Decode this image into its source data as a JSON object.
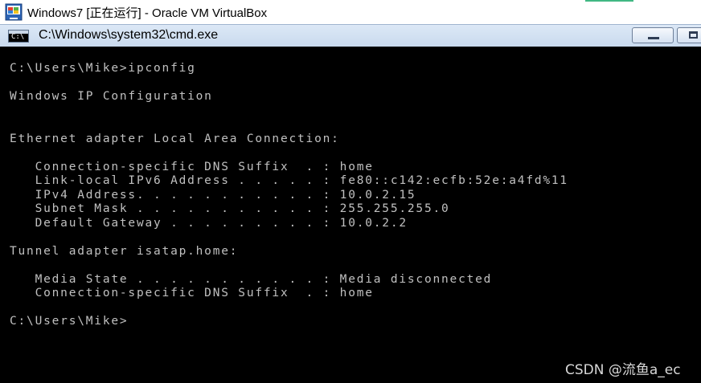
{
  "vbox": {
    "title": "Windows7 [正在运行] - Oracle VM VirtualBox"
  },
  "cmd": {
    "title": "C:\\Windows\\system32\\cmd.exe",
    "icon_glyph": "C:\\"
  },
  "console": {
    "lines": [
      "C:\\Users\\Mike>ipconfig",
      "Windows IP Configuration",
      "Ethernet adapter Local Area Connection:",
      "   Connection-specific DNS Suffix  . : home",
      "   Link-local IPv6 Address . . . . . : fe80::c142:ecfb:52e:a4fd%11",
      "   IPv4 Address. . . . . . . . . . . : 10.0.2.15",
      "   Subnet Mask . . . . . . . . . . . : 255.255.255.0",
      "   Default Gateway . . . . . . . . . : 10.0.2.2",
      "Tunnel adapter isatap.home:",
      "   Media State . . . . . . . . . . . : Media disconnected",
      "   Connection-specific DNS Suffix  . : home",
      "C:\\Users\\Mike>"
    ]
  },
  "watermark": "CSDN @流鱼a_ec",
  "colors": {
    "console_bg": "#000000",
    "console_text": "#c0c0c0",
    "titlebar_bg": "#dce8f6"
  }
}
